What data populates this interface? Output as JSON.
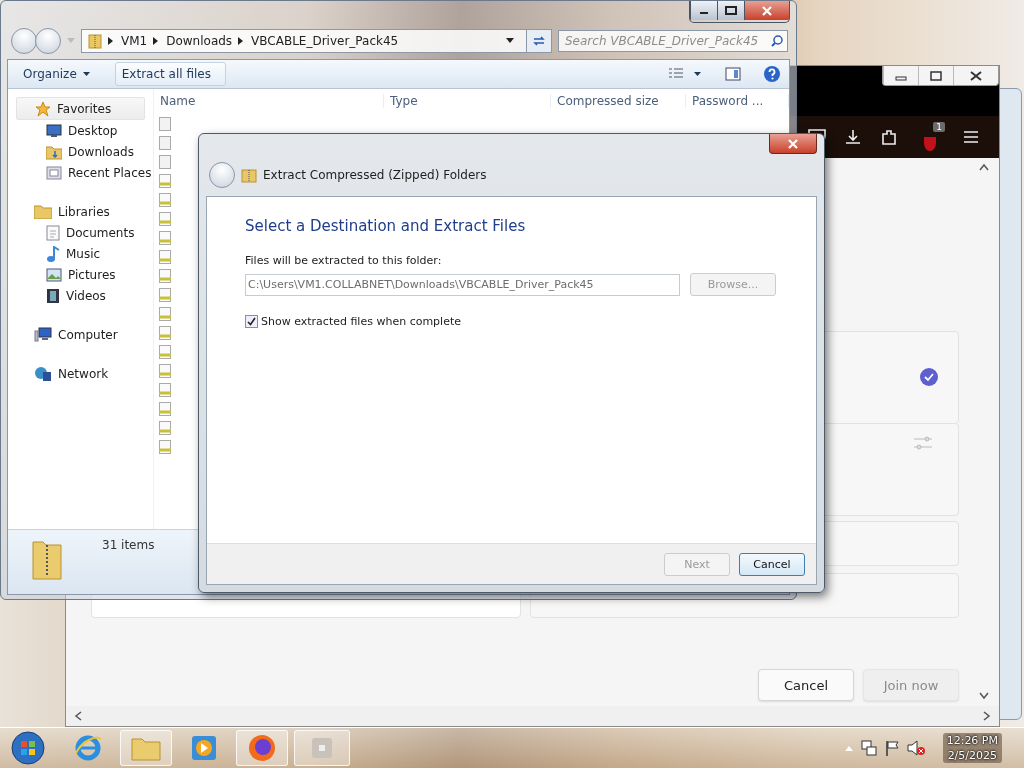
{
  "explorer": {
    "breadcrumb": [
      "VM1",
      "Downloads",
      "VBCABLE_Driver_Pack45"
    ],
    "search": {
      "placeholder": "Search VBCABLE_Driver_Pack45"
    },
    "toolbar": [
      "Organize",
      "Extract all files"
    ],
    "sidebar": [
      {
        "label": "Favorites",
        "selected": true,
        "children": [
          {
            "label": "Desktop",
            "selected": false
          },
          {
            "label": "Downloads",
            "selected": false
          },
          {
            "label": "Recent Places",
            "selected": false
          }
        ]
      },
      {
        "label": "Libraries",
        "selected": false,
        "children": [
          {
            "label": "Documents",
            "selected": false
          },
          {
            "label": "Music",
            "selected": false
          },
          {
            "label": "Pictures",
            "selected": false
          },
          {
            "label": "Videos",
            "selected": false
          }
        ]
      },
      {
        "label": "Computer",
        "selected": false
      },
      {
        "label": "Network",
        "selected": false
      }
    ],
    "columns": [
      "Name",
      "Type",
      "Compressed size",
      "Password ..."
    ],
    "status": "31 items"
  },
  "dialog": {
    "title": "Extract Compressed (Zipped) Folders",
    "heading": "Select a Destination and Extract Files",
    "field_label": "Files will be extracted to this folder:",
    "path": "C:\\Users\\VM1.COLLABNET\\Downloads\\VBCABLE_Driver_Pack45",
    "browse": {
      "label": "Browse...",
      "disabled": true
    },
    "checkbox": {
      "label": "Show extracted files when complete",
      "checked": true
    },
    "buttons": [
      {
        "label": "Next",
        "disabled": true
      },
      {
        "label": "Cancel",
        "disabled": false
      }
    ]
  },
  "browser": {
    "badge": "1",
    "buttons": [
      {
        "label": "Cancel",
        "disabled": false
      },
      {
        "label": "Join now",
        "disabled": true
      }
    ]
  },
  "taskbar": {
    "time": "12:26 PM",
    "date": "2/5/2025"
  }
}
